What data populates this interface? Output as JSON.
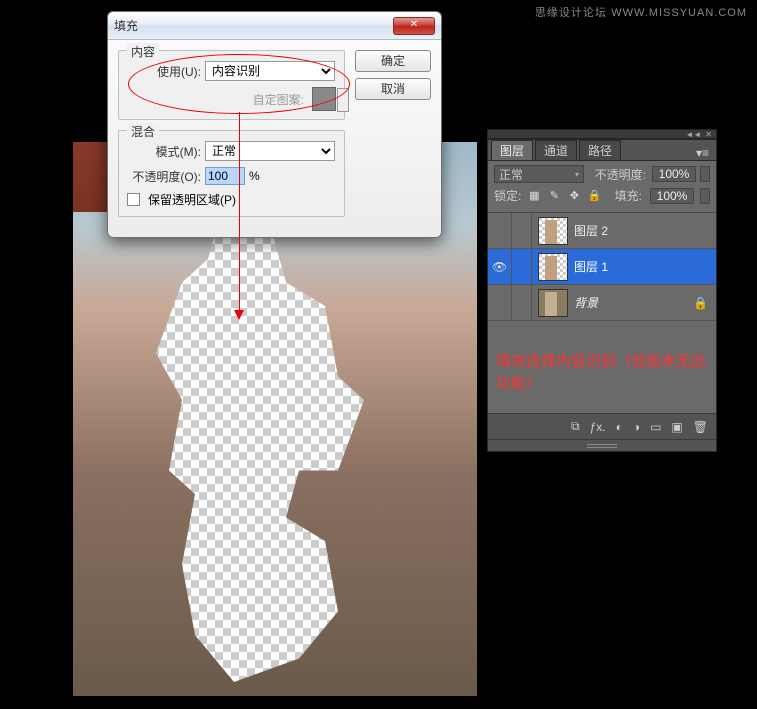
{
  "watermark": {
    "text": "思缘设计论坛",
    "url": "WWW.MISSYUAN.COM"
  },
  "dialog": {
    "title": "填充",
    "ok": "确定",
    "cancel": "取消",
    "content": {
      "legend": "内容",
      "use_label": "使用(U):",
      "use_value": "内容识别",
      "pattern_label": "自定图案:"
    },
    "blend": {
      "legend": "混合",
      "mode_label": "模式(M):",
      "mode_value": "正常",
      "opacity_label": "不透明度(O):",
      "opacity_value": "100",
      "opacity_unit": "%",
      "preserve_label": "保留透明区域(P)"
    }
  },
  "layers_panel": {
    "tabs": [
      "图层",
      "通道",
      "路径"
    ],
    "blend_mode": "正常",
    "opacity_label": "不透明度:",
    "opacity": "100%",
    "lock_label": "锁定:",
    "fill_label": "填充:",
    "fill": "100%",
    "layers": [
      {
        "name": "图层 2",
        "visible": false,
        "selected": false,
        "locked": false
      },
      {
        "name": "图层 1",
        "visible": true,
        "selected": true,
        "locked": false
      },
      {
        "name": "背景",
        "visible": false,
        "selected": false,
        "locked": true
      }
    ],
    "foot_icons": [
      "link",
      "fx",
      "mask",
      "adjust",
      "group",
      "new",
      "trash"
    ]
  },
  "annotation": "填充选择内容识别（低版本无此功能）"
}
